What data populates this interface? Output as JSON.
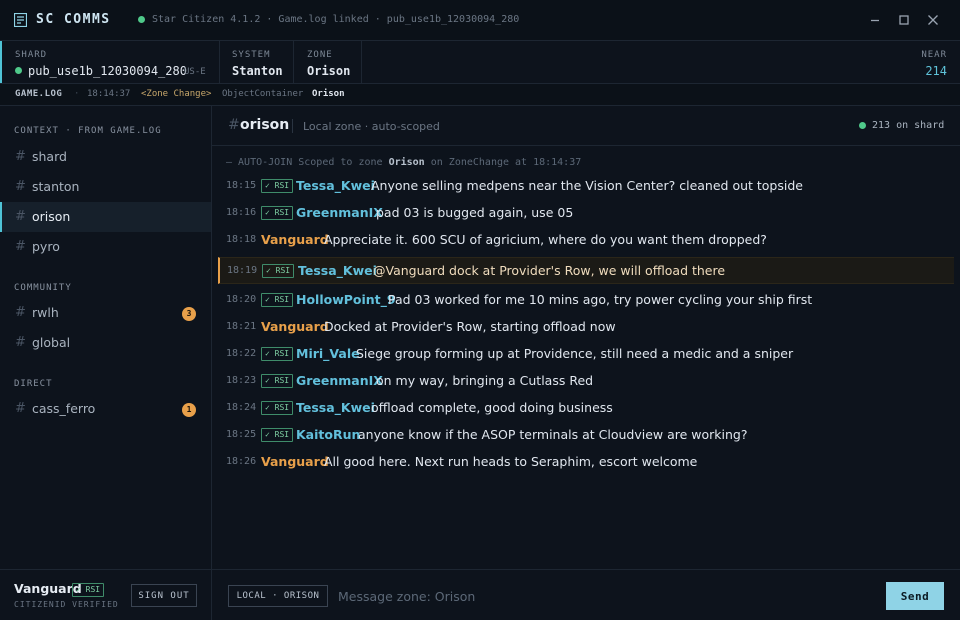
{
  "app": {
    "title": "SC COMMS",
    "status": "Star Citizen 4.1.2 · Game.log linked · pub_use1b_12030094_280"
  },
  "info": {
    "shard_label": "SHARD",
    "shard_value": "pub_use1b_12030094_280",
    "shard_region": "US-E",
    "system_label": "SYSTEM",
    "system_value": "Stanton",
    "zone_label": "ZONE",
    "zone_value": "Orison",
    "near_label": "NEAR",
    "near_value": "214"
  },
  "log": {
    "label": "GAME.LOG",
    "sep": "·",
    "time": "18:14:37",
    "event": "<Zone Change>",
    "object": "ObjectContainer",
    "zone": "Orison"
  },
  "sidebar": {
    "context_heading": "CONTEXT · FROM GAME.LOG",
    "context": [
      {
        "name": "shard"
      },
      {
        "name": "stanton"
      },
      {
        "name": "orison"
      },
      {
        "name": "pyro"
      }
    ],
    "community_heading": "COMMUNITY",
    "community": [
      {
        "name": "rwlh",
        "badge": "3"
      },
      {
        "name": "global"
      }
    ],
    "direct_heading": "DIRECT",
    "direct": [
      {
        "name": "cass_ferro",
        "badge": "1"
      }
    ],
    "hash": "#",
    "user": {
      "name": "Vanguard",
      "tag": "✓ RSI",
      "verified": "CITIZENID VERIFIED",
      "signout": "SIGN OUT"
    }
  },
  "channel": {
    "hash": "#",
    "name": "orison",
    "subtitle": "Local zone · auto-scoped",
    "online": "213 on shard"
  },
  "system_line": {
    "prefix": "— AUTO-JOIN Scoped to zone",
    "zone": "Orison",
    "mid": "on ZoneChange at 18:14:37"
  },
  "messages": [
    {
      "time": "18:15",
      "tag": "✓ RSI",
      "user": "Tessa_Kwei",
      "text": "Anyone selling medpens near the Vision Center? cleaned out topside"
    },
    {
      "time": "18:16",
      "tag": "✓ RSI",
      "user": "GreenmanIX",
      "text": "pad 03 is bugged again, use 05"
    },
    {
      "time": "18:18",
      "user": "Vanguard",
      "text": "Appreciate it. 600 SCU of agricium, where do you want them dropped?"
    },
    {
      "time": "18:19",
      "tag": "✓ RSI",
      "user": "Tessa_Kwei",
      "text": "@Vanguard dock at Provider's Row, we will offload there"
    },
    {
      "time": "18:20",
      "tag": "✓ RSI",
      "user": "HollowPoint_9",
      "text": "Pad 03 worked for me 10 mins ago, try power cycling your ship first"
    },
    {
      "time": "18:21",
      "user": "Vanguard",
      "text": "Docked at Provider's Row, starting offload now"
    },
    {
      "time": "18:22",
      "tag": "✓ RSI",
      "user": "Miri_Vale",
      "text": "Siege group forming up at Providence, still need a medic and a sniper"
    },
    {
      "time": "18:23",
      "tag": "✓ RSI",
      "user": "GreenmanIX",
      "text": "on my way, bringing a Cutlass Red"
    },
    {
      "time": "18:24",
      "tag": "✓ RSI",
      "user": "Tessa_Kwei",
      "text": "offload complete, good doing business"
    },
    {
      "time": "18:25",
      "tag": "✓ RSI",
      "user": "KaitoRun",
      "text": "anyone know if the ASOP terminals at Cloudview are working?"
    },
    {
      "time": "18:26",
      "user": "Vanguard",
      "text": "All good here. Next run heads to Seraphim, escort welcome"
    }
  ],
  "composer": {
    "scope": "LOCAL · ORISON",
    "placeholder": "Message zone: Orison",
    "send": "Send"
  },
  "colors": {
    "accent": "#4fc3d6",
    "online": "#4fc98a",
    "npc": "#e8a04a",
    "user": "#62c0dc"
  }
}
